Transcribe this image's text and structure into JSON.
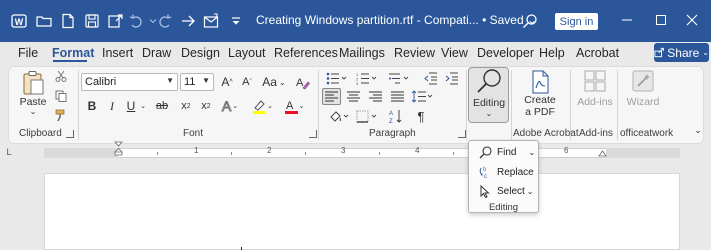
{
  "titlebar": {
    "title": "Creating Windows partition.rtf - Compati...",
    "saved": "• Saved",
    "signin": "Sign in"
  },
  "menu": {
    "items": [
      "File",
      "Format",
      "Insert",
      "Draw",
      "Design",
      "Layout",
      "References",
      "Mailings",
      "Review",
      "View",
      "Developer",
      "Help",
      "Acrobat"
    ],
    "active": "Format",
    "share": "Share"
  },
  "ribbon": {
    "clipboard": {
      "label": "Clipboard",
      "paste": "Paste"
    },
    "font": {
      "label": "Font",
      "name": "Calibri",
      "size": "11",
      "grow": "A",
      "shrink": "A",
      "case": "Aa",
      "bold": "B",
      "italic": "I",
      "underline": "U",
      "strike": "ab",
      "subscript": "x",
      "superscript": "x",
      "text_effects": "A",
      "font_color": "A"
    },
    "paragraph": {
      "label": "Paragraph"
    },
    "editing": {
      "label": "Editing"
    },
    "adobe": {
      "label": "Adobe Acrobat",
      "create_pdf_line1": "Create",
      "create_pdf_line2": "a PDF"
    },
    "addins": {
      "label": "Add-ins",
      "button": "Add-ins"
    },
    "officeatwork": {
      "label": "officeatwork",
      "button": "Wizard"
    }
  },
  "ruler": {
    "numbers": [
      "1",
      "2",
      "3",
      "4",
      "5",
      "6"
    ]
  },
  "editing_dropdown": {
    "items": [
      {
        "label": "Find",
        "icon": "search-icon"
      },
      {
        "label": "Replace",
        "icon": "replace-icon"
      },
      {
        "label": "Select",
        "icon": "cursor-icon"
      }
    ],
    "group_label": "Editing"
  },
  "colors": {
    "titlebar": "#2b579a",
    "highlight": "#ffff00",
    "font_color": "#e81123"
  }
}
